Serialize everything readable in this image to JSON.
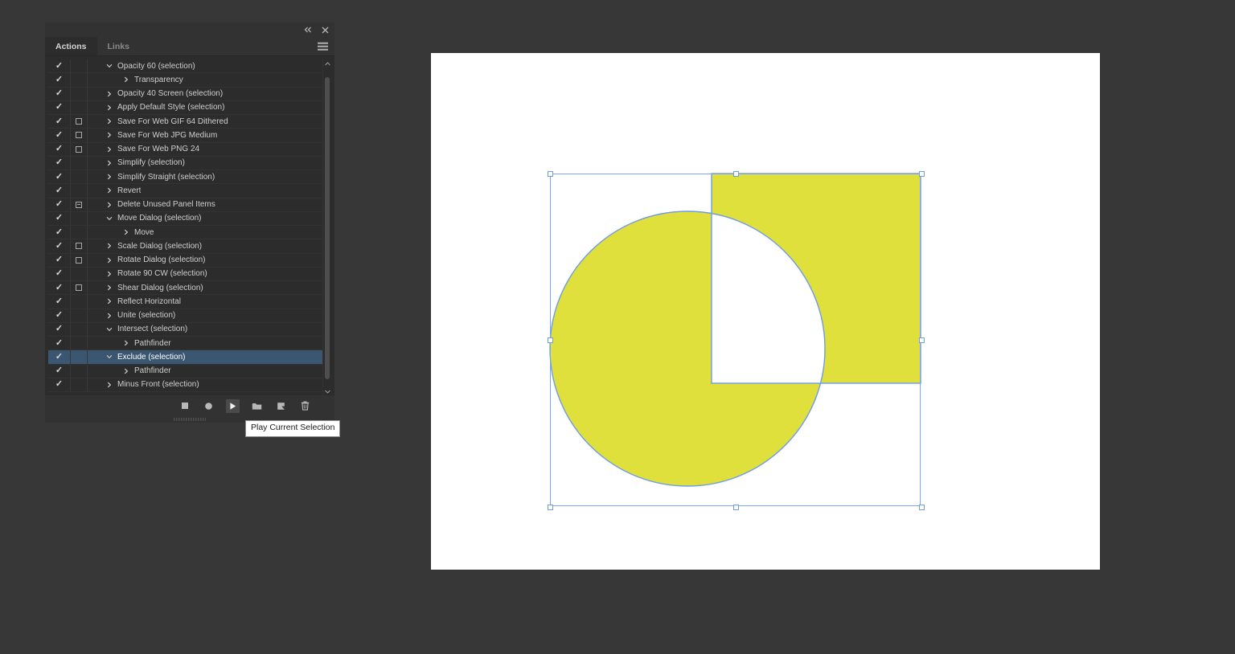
{
  "app": {
    "background_color": "#373737"
  },
  "panel": {
    "titlebar": {
      "collapse_icon": "double-chevron-left-icon",
      "close_icon": "close-icon"
    },
    "tabs": [
      {
        "label": "Actions",
        "active": true
      },
      {
        "label": "Links",
        "active": false
      }
    ],
    "menu_icon": "hamburger-menu-icon",
    "selected_color": "#3a5670",
    "rows": [
      {
        "label": "Opacity 60 (selection)",
        "checked": true,
        "dialog": "none",
        "twisty": "down",
        "indent": 0
      },
      {
        "label": "Transparency",
        "checked": true,
        "dialog": "none",
        "twisty": "right",
        "indent": 1
      },
      {
        "label": "Opacity 40 Screen (selection)",
        "checked": true,
        "dialog": "none",
        "twisty": "right",
        "indent": 0
      },
      {
        "label": "Apply Default Style (selection)",
        "checked": true,
        "dialog": "none",
        "twisty": "right",
        "indent": 0
      },
      {
        "label": "Save For Web GIF 64 Dithered",
        "checked": true,
        "dialog": "empty",
        "twisty": "right",
        "indent": 0
      },
      {
        "label": "Save For Web JPG Medium",
        "checked": true,
        "dialog": "empty",
        "twisty": "right",
        "indent": 0
      },
      {
        "label": "Save For Web PNG 24",
        "checked": true,
        "dialog": "empty",
        "twisty": "right",
        "indent": 0
      },
      {
        "label": "Simplify (selection)",
        "checked": true,
        "dialog": "none",
        "twisty": "right",
        "indent": 0
      },
      {
        "label": "Simplify Straight (selection)",
        "checked": true,
        "dialog": "none",
        "twisty": "right",
        "indent": 0
      },
      {
        "label": "Revert",
        "checked": true,
        "dialog": "none",
        "twisty": "right",
        "indent": 0
      },
      {
        "label": "Delete Unused Panel Items",
        "checked": true,
        "dialog": "partial",
        "twisty": "right",
        "indent": 0
      },
      {
        "label": "Move Dialog (selection)",
        "checked": true,
        "dialog": "none",
        "twisty": "down",
        "indent": 0
      },
      {
        "label": "Move",
        "checked": true,
        "dialog": "none",
        "twisty": "right",
        "indent": 1
      },
      {
        "label": "Scale Dialog (selection)",
        "checked": true,
        "dialog": "empty",
        "twisty": "right",
        "indent": 0
      },
      {
        "label": "Rotate Dialog (selection)",
        "checked": true,
        "dialog": "empty",
        "twisty": "right",
        "indent": 0
      },
      {
        "label": "Rotate 90 CW (selection)",
        "checked": true,
        "dialog": "none",
        "twisty": "right",
        "indent": 0
      },
      {
        "label": "Shear Dialog (selection)",
        "checked": true,
        "dialog": "empty",
        "twisty": "right",
        "indent": 0
      },
      {
        "label": "Reflect Horizontal",
        "checked": true,
        "dialog": "none",
        "twisty": "right",
        "indent": 0
      },
      {
        "label": "Unite (selection)",
        "checked": true,
        "dialog": "none",
        "twisty": "right",
        "indent": 0
      },
      {
        "label": "Intersect (selection)",
        "checked": true,
        "dialog": "none",
        "twisty": "down",
        "indent": 0
      },
      {
        "label": "Pathfinder",
        "checked": true,
        "dialog": "none",
        "twisty": "right",
        "indent": 1
      },
      {
        "label": "Exclude (selection)",
        "checked": true,
        "dialog": "none",
        "twisty": "down",
        "indent": 0,
        "selected": true
      },
      {
        "label": "Pathfinder",
        "checked": true,
        "dialog": "none",
        "twisty": "right",
        "indent": 1
      },
      {
        "label": "Minus Front (selection)",
        "checked": true,
        "dialog": "none",
        "twisty": "right",
        "indent": 0
      }
    ],
    "toolbar": [
      {
        "icon": "stop-icon",
        "name": "stop-button",
        "active": false
      },
      {
        "icon": "record-icon",
        "name": "begin-recording-button",
        "active": false
      },
      {
        "icon": "play-icon",
        "name": "play-current-selection-button",
        "active": true
      },
      {
        "icon": "new-set-icon",
        "name": "create-new-set-button",
        "active": false
      },
      {
        "icon": "new-action-icon",
        "name": "create-new-action-button",
        "active": false
      },
      {
        "icon": "trash-icon",
        "name": "delete-selection-button",
        "active": false
      }
    ],
    "scrollbar": {
      "up_icon": "chevron-up-icon",
      "down_icon": "chevron-down-icon"
    }
  },
  "tooltip": {
    "text": "Play Current Selection"
  },
  "artwork": {
    "fill_color": "#dfe03c",
    "stroke_color": "#6f9be8",
    "selection_color": "#7aa7ef",
    "canvas_color": "#ffffff",
    "description": "Exclude pathfinder result of circle and square"
  }
}
